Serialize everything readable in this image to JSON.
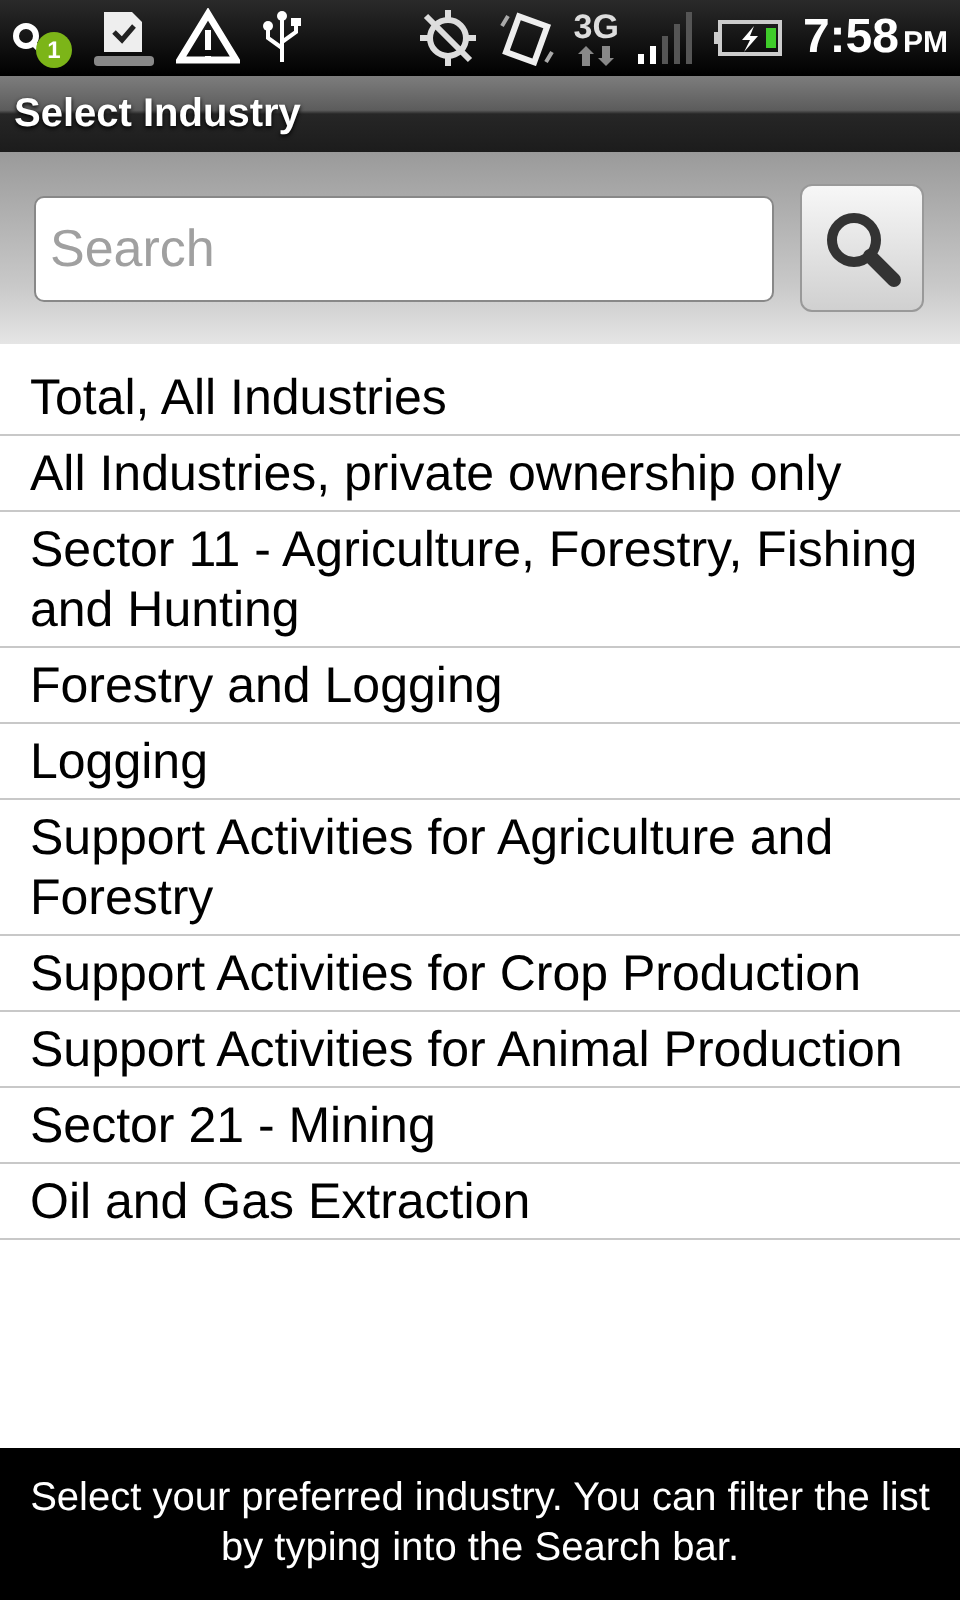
{
  "status_bar": {
    "notification_count": "1",
    "network": "3G",
    "time": "7:58",
    "period": "PM"
  },
  "title": "Select Industry",
  "search": {
    "placeholder": "Search"
  },
  "industries": [
    {
      "label": "Total, All Industries"
    },
    {
      "label": "All Industries, private ownership only"
    },
    {
      "label": "Sector 11 - Agriculture, Forestry, Fishing and Hunting"
    },
    {
      "label": "Forestry and Logging"
    },
    {
      "label": "Logging"
    },
    {
      "label": "Support Activities for Agriculture and Forestry"
    },
    {
      "label": "Support Activities for Crop Production"
    },
    {
      "label": "Support Activities for Animal Production"
    },
    {
      "label": "Sector 21 - Mining"
    },
    {
      "label": "Oil and Gas Extraction"
    }
  ],
  "toast": "Select your preferred industry. You can filter the list by typing into the Search bar."
}
